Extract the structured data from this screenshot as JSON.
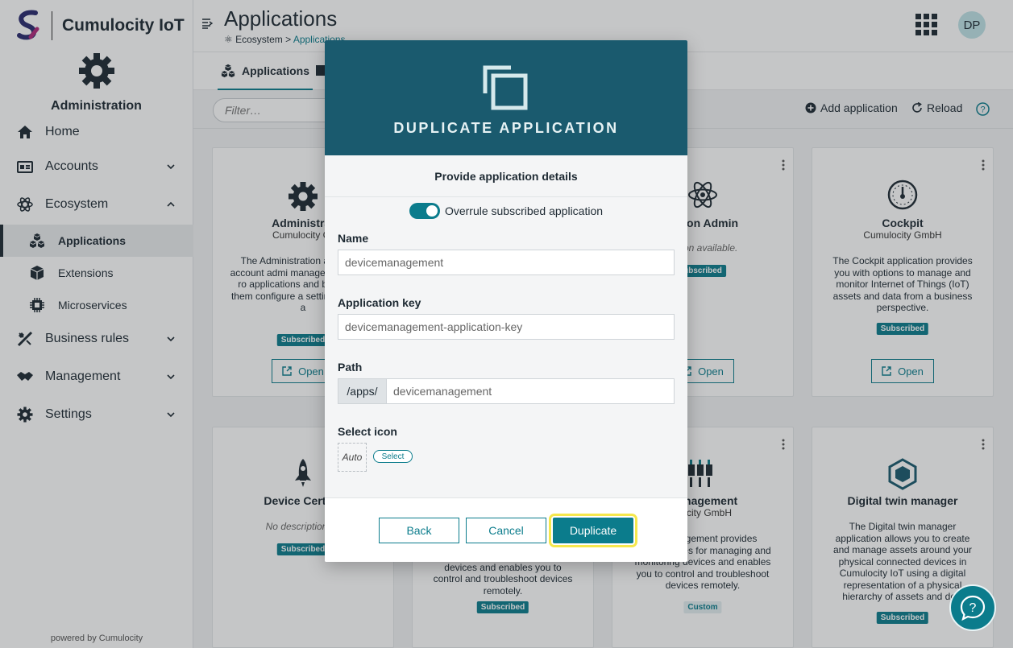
{
  "brand": {
    "name": "Cumulocity IoT",
    "app_name": "Administration",
    "powered_by": "powered by Cumulocity"
  },
  "nav": {
    "home": "Home",
    "accounts": "Accounts",
    "ecosystem": "Ecosystem",
    "applications": "Applications",
    "extensions": "Extensions",
    "microservices": "Microservices",
    "business_rules": "Business rules",
    "management": "Management",
    "settings": "Settings"
  },
  "header": {
    "title": "Applications",
    "breadcrumb_root": "Ecosystem",
    "breadcrumb_sep": ">",
    "breadcrumb_current": "Applications",
    "avatar": "DP"
  },
  "tabs": {
    "applications": "Applications"
  },
  "toolbar": {
    "filter_placeholder": "Filter…",
    "add_application": "Add application",
    "reload": "Reload"
  },
  "cards": [
    {
      "title": "Administrat",
      "vendor": "Cumulocity Gr",
      "description": "The Administration a enables account admi manage their users, ro applications and busine lets them configure a settings for their a",
      "badge": "Subscribed",
      "open": "Open"
    },
    {
      "title": "cation Admin",
      "vendor": "",
      "description": "ription available.",
      "badge": "ubscribed",
      "open": "Open"
    },
    {
      "title": "Cockpit",
      "vendor": "Cumulocity GmbH",
      "description": "The Cockpit application provides you with options to manage and monitor Internet of Things (IoT) assets and data from a business perspective.",
      "badge": "Subscribed",
      "open": "Open"
    },
    {
      "title": "Device Certific",
      "vendor": "",
      "description": "No description av",
      "badge": "Subscribed",
      "open": ""
    },
    {
      "title": "",
      "vendor": "",
      "description": "for managing and monitoring devices and enables you to control and troubleshoot devices remotely.",
      "badge": "Subscribed",
      "open": ""
    },
    {
      "title": "management",
      "vendor": "ulocity GmbH",
      "description": "ce Management provides functionalities for managing and monitoring devices and enables you to control and troubleshoot devices remotely.",
      "badge": "Custom",
      "open": ""
    },
    {
      "title": "Digital twin manager",
      "vendor": "",
      "description": "The Digital twin manager application allows you to create and manage assets around your physical connected devices in Cumulocity IoT using a digital representation of a physical hierarchy of assets and devi",
      "badge": "Subscribed",
      "open": ""
    }
  ],
  "dialog": {
    "title": "DUPLICATE APPLICATION",
    "subtitle": "Provide application details",
    "toggle_label": "Overrule subscribed application",
    "toggle_on": true,
    "name_label": "Name",
    "name_value": "devicemanagement",
    "key_label": "Application key",
    "key_value": "devicemanagement-application-key",
    "path_label": "Path",
    "path_prefix": "/apps/",
    "path_value": "devicemanagement",
    "icon_label": "Select icon",
    "icon_auto": "Auto",
    "icon_select": "Select",
    "back": "Back",
    "cancel": "Cancel",
    "duplicate": "Duplicate"
  },
  "colors": {
    "accent": "#0b7c8c",
    "dialog_header": "#1a5a6e",
    "focus_outline": "#f5e74c"
  }
}
